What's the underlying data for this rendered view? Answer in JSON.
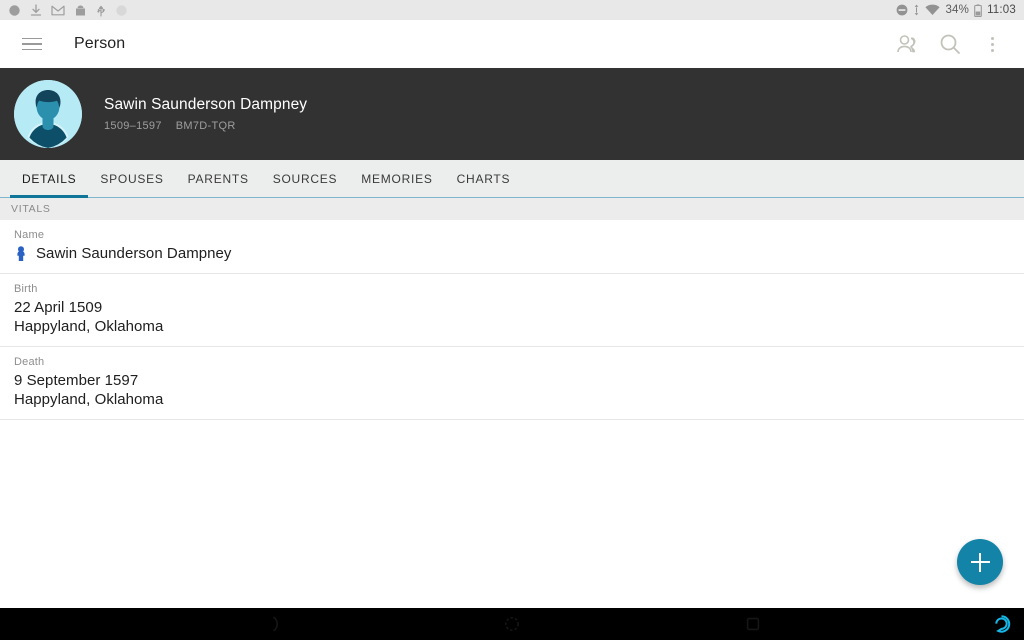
{
  "statusbar": {
    "left_icons": [
      "circle-icon",
      "download-icon",
      "gmail-icon",
      "package-icon",
      "usb-icon",
      "circle-outline-icon"
    ],
    "right_icons": [
      "do-not-disturb-icon",
      "sync-icon",
      "wifi-icon",
      "battery-icon"
    ],
    "battery": "34%",
    "time": "11:03"
  },
  "appbar": {
    "menu_icon": "hamburger-menu-icon",
    "title": "Person",
    "actions": [
      {
        "name": "people-icon"
      },
      {
        "name": "search-icon"
      },
      {
        "name": "overflow-menu-icon"
      }
    ]
  },
  "person": {
    "avatar": "person-avatar",
    "name": "Sawin Saunderson Dampney",
    "lifespan": "1509–1597",
    "id": "BM7D-TQR"
  },
  "tabs": [
    {
      "label": "DETAILS",
      "active": true
    },
    {
      "label": "SPOUSES",
      "active": false
    },
    {
      "label": "PARENTS",
      "active": false
    },
    {
      "label": "SOURCES",
      "active": false
    },
    {
      "label": "MEMORIES",
      "active": false
    },
    {
      "label": "CHARTS",
      "active": false
    }
  ],
  "details": {
    "section_title": "VITALS",
    "rows": [
      {
        "label": "Name",
        "icon": "male-gender-icon",
        "value": "Sawin Saunderson Dampney",
        "secondary": ""
      },
      {
        "label": "Birth",
        "icon": "",
        "value": "22 April 1509",
        "secondary": "Happyland, Oklahoma"
      },
      {
        "label": "Death",
        "icon": "",
        "value": "9 September 1597",
        "secondary": "Happyland, Oklahoma"
      }
    ]
  },
  "fab": {
    "name": "add-button",
    "icon": "plus-icon"
  },
  "navbar": {
    "buttons": [
      "back-button",
      "home-button",
      "recents-button"
    ],
    "assistant": "assistant-icon"
  },
  "colors": {
    "accent": "#0f7599",
    "fab": "#1383a8",
    "header_bg": "#323232",
    "tab_bg": "#eceded",
    "assistant": "#16b8e8"
  }
}
